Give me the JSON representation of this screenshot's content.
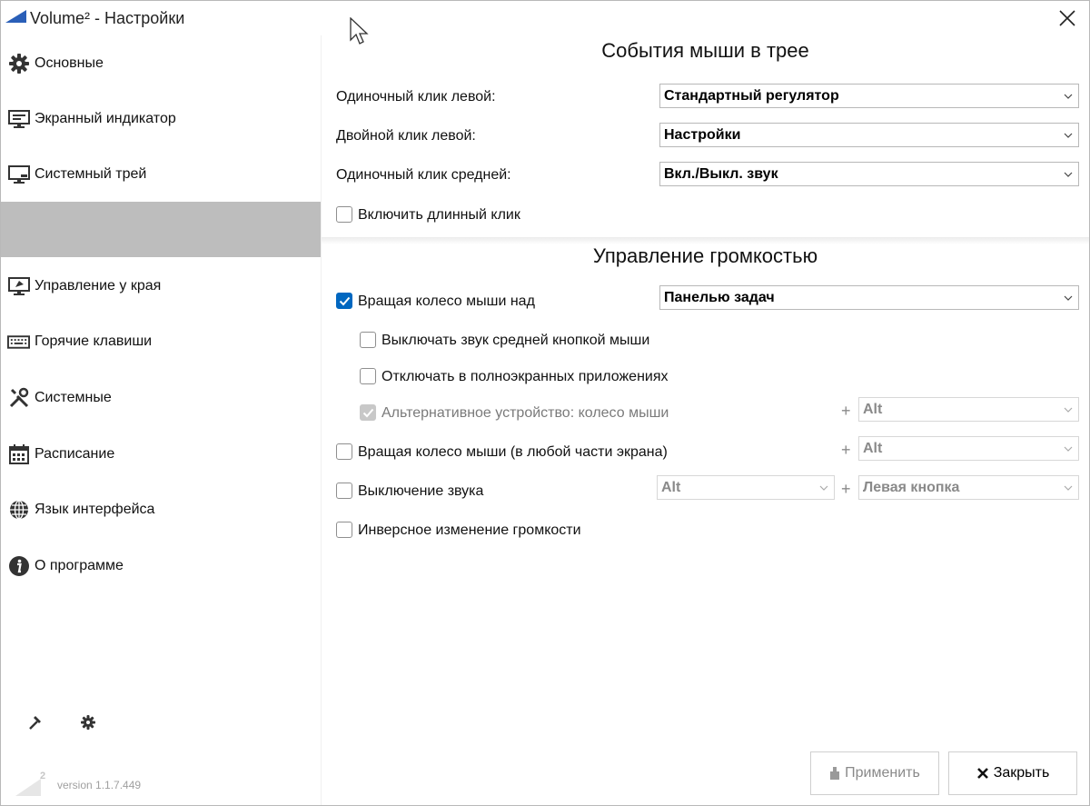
{
  "window": {
    "title": "Volume² - Настройки"
  },
  "sidebar": {
    "items": [
      {
        "label": "Основные",
        "icon": "gear-icon"
      },
      {
        "label": "Экранный индикатор",
        "icon": "monitor-icon"
      },
      {
        "label": "Системный трей",
        "icon": "tray-icon"
      },
      {
        "label": "",
        "icon": "",
        "selected": true
      },
      {
        "label": "Управление у края",
        "icon": "screen-edge-icon"
      },
      {
        "label": "Горячие клавиши",
        "icon": "keyboard-icon"
      },
      {
        "label": "Системные",
        "icon": "tools-icon"
      },
      {
        "label": "Расписание",
        "icon": "calendar-icon"
      },
      {
        "label": "Язык интерфейса",
        "icon": "globe-icon"
      },
      {
        "label": "О программе",
        "icon": "info-icon"
      }
    ],
    "version": "version 1.1.7.449",
    "logo_sup": "2"
  },
  "mouse_events": {
    "title": "События мыши в трее",
    "single_left": {
      "label": "Одиночный клик левой:",
      "value": "Стандартный регулятор"
    },
    "double_left": {
      "label": "Двойной клик левой:",
      "value": "Настройки"
    },
    "single_middle": {
      "label": "Одиночный клик средней:",
      "value": "Вкл./Выкл. звук"
    },
    "long_click": {
      "label": "Включить длинный клик",
      "checked": false
    }
  },
  "volume_control": {
    "title": "Управление громкостью",
    "wheel_over": {
      "label": "Вращая колесо мыши над",
      "checked": true,
      "value": "Панелью задач"
    },
    "mute_middle": {
      "label": "Выключать звук средней кнопкой мыши",
      "checked": false
    },
    "disable_fullscreen": {
      "label": "Отключать в полноэкранных приложениях",
      "checked": false
    },
    "alt_device": {
      "label": "Альтернативное устройство: колесо мыши",
      "checked": true,
      "disabled": true,
      "plus": "+",
      "modifier": "Alt"
    },
    "wheel_anywhere": {
      "label": "Вращая колесо мыши (в любой части экрана)",
      "checked": false,
      "plus": "+",
      "modifier": "Alt"
    },
    "mute": {
      "label": "Выключение звука",
      "checked": false,
      "modifier": "Alt",
      "plus": "+",
      "button": "Левая кнопка"
    },
    "inverse": {
      "label": "Инверсное изменение громкости",
      "checked": false
    }
  },
  "footer": {
    "apply": "Применить",
    "close": "Закрыть"
  },
  "colors": {
    "accent": "#0067c0",
    "selected_item": "#bdbdbd"
  }
}
